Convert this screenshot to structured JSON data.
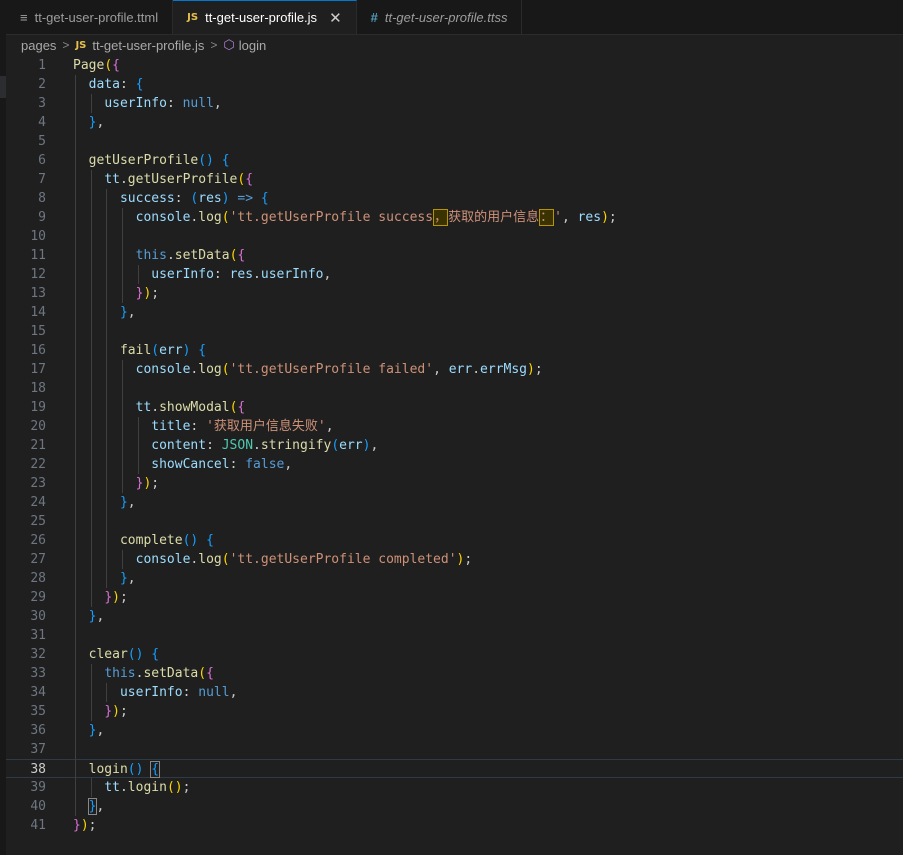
{
  "tabs": [
    {
      "label": "tt-get-user-profile.ttml",
      "icon": "lines-icon",
      "active": false
    },
    {
      "label": "tt-get-user-profile.js",
      "icon": "js-icon",
      "active": true
    },
    {
      "label": "tt-get-user-profile.ttss",
      "icon": "hash-icon",
      "active": false
    }
  ],
  "tab_icons": {
    "js": "JS",
    "lines": "≡",
    "hash": "#",
    "close": "✕"
  },
  "breadcrumb": {
    "folder": "pages",
    "file": "tt-get-user-profile.js",
    "symbol": "login",
    "sep": ">"
  },
  "editor": {
    "current_line": 38,
    "lines": [
      [
        [
          "Page",
          "f"
        ],
        [
          "(",
          "b1"
        ],
        [
          "{",
          "b2"
        ]
      ],
      [
        [
          "  ",
          "p"
        ],
        [
          "data",
          "v"
        ],
        [
          ": ",
          "p"
        ],
        [
          "{",
          "b3"
        ]
      ],
      [
        [
          "    ",
          "p"
        ],
        [
          "userInfo",
          "v"
        ],
        [
          ": ",
          "p"
        ],
        [
          "null",
          "k"
        ],
        [
          ",",
          "p"
        ]
      ],
      [
        [
          "  ",
          "p"
        ],
        [
          "}",
          "b3"
        ],
        [
          ",",
          "p"
        ]
      ],
      [],
      [
        [
          "  ",
          "p"
        ],
        [
          "getUserProfile",
          "f"
        ],
        [
          "() ",
          "b3"
        ],
        [
          "{",
          "b3"
        ]
      ],
      [
        [
          "    ",
          "p"
        ],
        [
          "tt",
          "v"
        ],
        [
          ".",
          "p"
        ],
        [
          "getUserProfile",
          "f"
        ],
        [
          "(",
          "b1"
        ],
        [
          "{",
          "b2"
        ]
      ],
      [
        [
          "      ",
          "p"
        ],
        [
          "success",
          "v"
        ],
        [
          ": ",
          "p"
        ],
        [
          "(",
          "b3"
        ],
        [
          "res",
          "v"
        ],
        [
          ") ",
          "b3"
        ],
        [
          "=>",
          "k"
        ],
        [
          " ",
          "p"
        ],
        [
          "{",
          "b3"
        ]
      ],
      [
        [
          "        ",
          "p"
        ],
        [
          "console",
          "v"
        ],
        [
          ".",
          "p"
        ],
        [
          "log",
          "f"
        ],
        [
          "(",
          "b1"
        ],
        [
          "'tt.getUserProfile success",
          "s"
        ],
        [
          "，",
          "s hl"
        ],
        [
          "获取的用户信息",
          "s"
        ],
        [
          "：",
          "s hl"
        ],
        [
          "'",
          "s"
        ],
        [
          ", ",
          "p"
        ],
        [
          "res",
          "v"
        ],
        [
          ")",
          "b1"
        ],
        [
          ";",
          "p"
        ]
      ],
      [],
      [
        [
          "        ",
          "p"
        ],
        [
          "this",
          "k"
        ],
        [
          ".",
          "p"
        ],
        [
          "setData",
          "f"
        ],
        [
          "(",
          "b1"
        ],
        [
          "{",
          "b2"
        ]
      ],
      [
        [
          "          ",
          "p"
        ],
        [
          "userInfo",
          "v"
        ],
        [
          ": ",
          "p"
        ],
        [
          "res",
          "v"
        ],
        [
          ".",
          "p"
        ],
        [
          "userInfo",
          "v"
        ],
        [
          ",",
          "p"
        ]
      ],
      [
        [
          "        ",
          "p"
        ],
        [
          "}",
          "b2"
        ],
        [
          ")",
          "b1"
        ],
        [
          ";",
          "p"
        ]
      ],
      [
        [
          "      ",
          "p"
        ],
        [
          "}",
          "b3"
        ],
        [
          ",",
          "p"
        ]
      ],
      [],
      [
        [
          "      ",
          "p"
        ],
        [
          "fail",
          "f"
        ],
        [
          "(",
          "b3"
        ],
        [
          "err",
          "v"
        ],
        [
          ") ",
          "b3"
        ],
        [
          "{",
          "b3"
        ]
      ],
      [
        [
          "        ",
          "p"
        ],
        [
          "console",
          "v"
        ],
        [
          ".",
          "p"
        ],
        [
          "log",
          "f"
        ],
        [
          "(",
          "b1"
        ],
        [
          "'tt.getUserProfile failed'",
          "s"
        ],
        [
          ", ",
          "p"
        ],
        [
          "err",
          "v"
        ],
        [
          ".",
          "p"
        ],
        [
          "errMsg",
          "v"
        ],
        [
          ")",
          "b1"
        ],
        [
          ";",
          "p"
        ]
      ],
      [],
      [
        [
          "        ",
          "p"
        ],
        [
          "tt",
          "v"
        ],
        [
          ".",
          "p"
        ],
        [
          "showModal",
          "f"
        ],
        [
          "(",
          "b1"
        ],
        [
          "{",
          "b2"
        ]
      ],
      [
        [
          "          ",
          "p"
        ],
        [
          "title",
          "v"
        ],
        [
          ": ",
          "p"
        ],
        [
          "'获取用户信息失败'",
          "s"
        ],
        [
          ",",
          "p"
        ]
      ],
      [
        [
          "          ",
          "p"
        ],
        [
          "content",
          "v"
        ],
        [
          ": ",
          "p"
        ],
        [
          "JSON",
          "c"
        ],
        [
          ".",
          "p"
        ],
        [
          "stringify",
          "f"
        ],
        [
          "(",
          "b3"
        ],
        [
          "err",
          "v"
        ],
        [
          ")",
          "b3"
        ],
        [
          ",",
          "p"
        ]
      ],
      [
        [
          "          ",
          "p"
        ],
        [
          "showCancel",
          "v"
        ],
        [
          ": ",
          "p"
        ],
        [
          "false",
          "k"
        ],
        [
          ",",
          "p"
        ]
      ],
      [
        [
          "        ",
          "p"
        ],
        [
          "}",
          "b2"
        ],
        [
          ")",
          "b1"
        ],
        [
          ";",
          "p"
        ]
      ],
      [
        [
          "      ",
          "p"
        ],
        [
          "}",
          "b3"
        ],
        [
          ",",
          "p"
        ]
      ],
      [],
      [
        [
          "      ",
          "p"
        ],
        [
          "complete",
          "f"
        ],
        [
          "() ",
          "b3"
        ],
        [
          "{",
          "b3"
        ]
      ],
      [
        [
          "        ",
          "p"
        ],
        [
          "console",
          "v"
        ],
        [
          ".",
          "p"
        ],
        [
          "log",
          "f"
        ],
        [
          "(",
          "b1"
        ],
        [
          "'tt.getUserProfile completed'",
          "s"
        ],
        [
          ")",
          "b1"
        ],
        [
          ";",
          "p"
        ]
      ],
      [
        [
          "      ",
          "p"
        ],
        [
          "}",
          "b3"
        ],
        [
          ",",
          "p"
        ]
      ],
      [
        [
          "    ",
          "p"
        ],
        [
          "}",
          "b2"
        ],
        [
          ")",
          "b1"
        ],
        [
          ";",
          "p"
        ]
      ],
      [
        [
          "  ",
          "p"
        ],
        [
          "}",
          "b3"
        ],
        [
          ",",
          "p"
        ]
      ],
      [],
      [
        [
          "  ",
          "p"
        ],
        [
          "clear",
          "f"
        ],
        [
          "() ",
          "b3"
        ],
        [
          "{",
          "b3"
        ]
      ],
      [
        [
          "    ",
          "p"
        ],
        [
          "this",
          "k"
        ],
        [
          ".",
          "p"
        ],
        [
          "setData",
          "f"
        ],
        [
          "(",
          "b1"
        ],
        [
          "{",
          "b2"
        ]
      ],
      [
        [
          "      ",
          "p"
        ],
        [
          "userInfo",
          "v"
        ],
        [
          ": ",
          "p"
        ],
        [
          "null",
          "k"
        ],
        [
          ",",
          "p"
        ]
      ],
      [
        [
          "    ",
          "p"
        ],
        [
          "}",
          "b2"
        ],
        [
          ")",
          "b1"
        ],
        [
          ";",
          "p"
        ]
      ],
      [
        [
          "  ",
          "p"
        ],
        [
          "}",
          "b3"
        ],
        [
          ",",
          "p"
        ]
      ],
      [],
      [
        [
          "  ",
          "p"
        ],
        [
          "login",
          "f"
        ],
        [
          "() ",
          "b3"
        ],
        [
          "{",
          "b3 mbr"
        ]
      ],
      [
        [
          "    ",
          "p"
        ],
        [
          "tt",
          "v"
        ],
        [
          ".",
          "p"
        ],
        [
          "login",
          "f"
        ],
        [
          "(",
          "b1"
        ],
        [
          ")",
          "b1"
        ],
        [
          ";",
          "p"
        ]
      ],
      [
        [
          "  ",
          "p"
        ],
        [
          "}",
          "b3 mbr"
        ],
        [
          ",",
          "p"
        ]
      ],
      [
        [
          "}",
          "b2"
        ],
        [
          ")",
          "b1"
        ],
        [
          ";",
          "p"
        ]
      ]
    ]
  }
}
